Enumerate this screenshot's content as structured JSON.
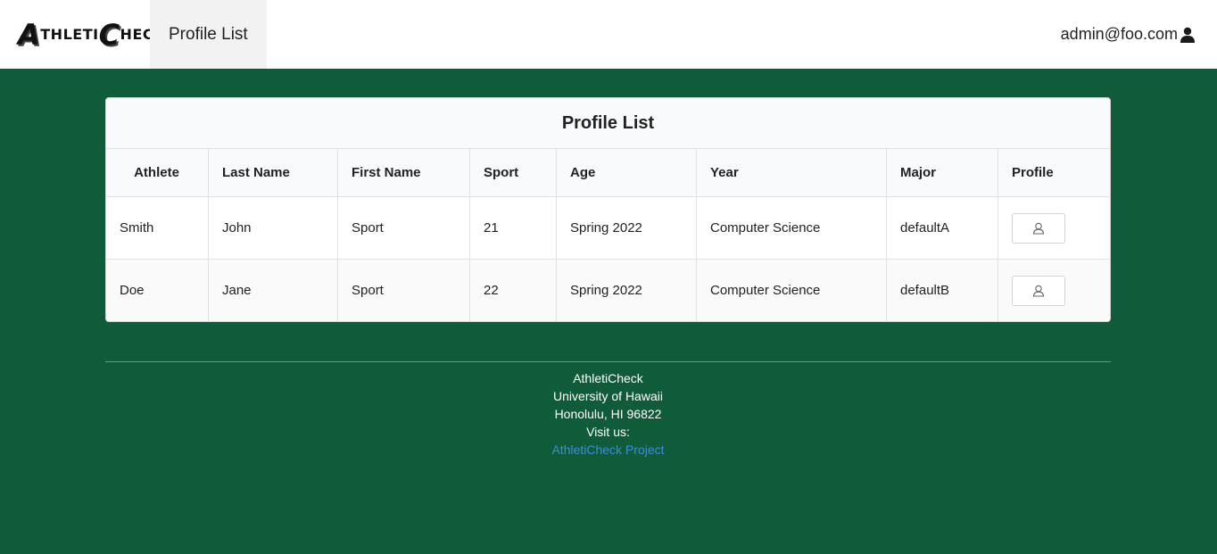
{
  "navbar": {
    "logo_text": "AthletiCheck",
    "logo_letter_a": "A",
    "logo_part1": "THLETI",
    "logo_letter_c": "C",
    "logo_part2": "HECK",
    "nav_item": "Profile List",
    "user_email": "admin@foo.com",
    "user_icon": "user-icon"
  },
  "table": {
    "title": "Profile List",
    "headers": [
      "Athlete",
      "Last Name",
      "First Name",
      "Sport",
      "Age",
      "Year",
      "Major",
      "Profile"
    ],
    "rows": [
      {
        "c0": "Smith",
        "c1": "John",
        "c2": "Sport",
        "c3": "21",
        "c4": "Spring 2022",
        "c5": "Computer Science",
        "c6": "defaultA",
        "profile_icon": "user-outline-icon"
      },
      {
        "c0": "Doe",
        "c1": "Jane",
        "c2": "Sport",
        "c3": "22",
        "c4": "Spring 2022",
        "c5": "Computer Science",
        "c6": "defaultB",
        "profile_icon": "user-outline-icon"
      }
    ]
  },
  "footer": {
    "line1": "AthletiCheck",
    "line2": "University of Hawaii",
    "line3": "Honolulu, HI 96822",
    "line4": "Visit us:",
    "link": "AthletiCheck Project"
  },
  "colors": {
    "background": "#0f5b3a",
    "link": "#3b8fd9"
  }
}
